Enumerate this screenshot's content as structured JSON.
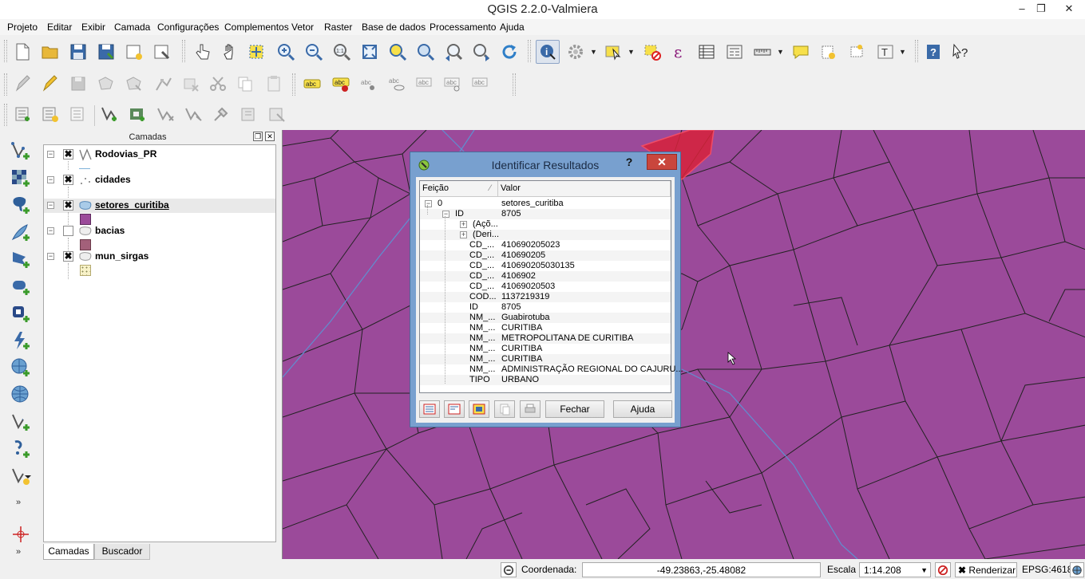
{
  "window": {
    "title": "QGIS 2.2.0-Valmiera",
    "minimize_glyph": "–",
    "restore_glyph": "❐",
    "close_glyph": "✕"
  },
  "menu": [
    "Projeto",
    "Editar",
    "Exibir",
    "Camada",
    "Configurações",
    "Complementos",
    "Vetor",
    "Raster",
    "Base de dados",
    "Processamento",
    "Ajuda"
  ],
  "layers_panel": {
    "title": "Camadas",
    "layers": [
      {
        "name": "Rodovias_PR",
        "checked": true,
        "geometry": "line",
        "symbol_color": "#7fb2d9"
      },
      {
        "name": "cidades",
        "checked": true,
        "geometry": "point",
        "symbol_color": "#8a1a7a"
      },
      {
        "name": "setores_curitiba",
        "checked": true,
        "geometry": "polygon",
        "symbol_color": "#9b4a9a",
        "current": true
      },
      {
        "name": "bacias",
        "checked": false,
        "geometry": "polygon",
        "symbol_color": "#a3607a"
      },
      {
        "name": "mun_sirgas",
        "checked": true,
        "geometry": "polygon",
        "symbol_color": "#f8f2c8"
      }
    ],
    "tabs": [
      "Camadas",
      "Buscador"
    ]
  },
  "identify_dialog": {
    "title": "Identificar Resultados",
    "help_glyph": "?",
    "close_glyph": "✕",
    "columns": [
      "Feição",
      "Valor"
    ],
    "rows": [
      {
        "key": "0",
        "value": "setores_curitiba",
        "level": 0,
        "expander": "−"
      },
      {
        "key": "ID",
        "value": "8705",
        "level": 1,
        "expander": "−"
      },
      {
        "key": "(Açõ...",
        "value": "",
        "level": 2,
        "expander": "+"
      },
      {
        "key": "(Deri...",
        "value": "",
        "level": 2,
        "expander": "+"
      },
      {
        "key": "CD_...",
        "value": "410690205023",
        "level": 2
      },
      {
        "key": "CD_...",
        "value": "410690205",
        "level": 2
      },
      {
        "key": "CD_...",
        "value": "410690205030135",
        "level": 2
      },
      {
        "key": "CD_...",
        "value": "4106902",
        "level": 2
      },
      {
        "key": "CD_...",
        "value": "41069020503",
        "level": 2
      },
      {
        "key": "COD...",
        "value": "1137219319",
        "level": 2
      },
      {
        "key": "ID",
        "value": "8705",
        "level": 2
      },
      {
        "key": "NM_...",
        "value": "Guabirotuba",
        "level": 2
      },
      {
        "key": "NM_...",
        "value": "CURITIBA",
        "level": 2
      },
      {
        "key": "NM_...",
        "value": "METROPOLITANA DE CURITIBA",
        "level": 2
      },
      {
        "key": "NM_...",
        "value": "CURITIBA",
        "level": 2
      },
      {
        "key": "NM_...",
        "value": "CURITIBA",
        "level": 2
      },
      {
        "key": "NM_...",
        "value": "ADMINISTRAÇÃO REGIONAL DO CAJURU...",
        "level": 2
      },
      {
        "key": "TIPO",
        "value": "URBANO",
        "level": 2
      }
    ],
    "buttons": {
      "close": "Fechar",
      "help": "Ajuda"
    }
  },
  "status": {
    "coord_label": "Coordenada:",
    "coord_value": "-49.23863,-25.48082",
    "scale_label": "Escala",
    "scale_value": "1:14.208",
    "render_label": "Renderizar",
    "crs": "EPSG:4618"
  },
  "colors": {
    "map_fill": "#9b4a9a",
    "selected_feature": "#d8223a",
    "road": "#5f8fd0",
    "dialog_frame": "#78a0cf"
  }
}
